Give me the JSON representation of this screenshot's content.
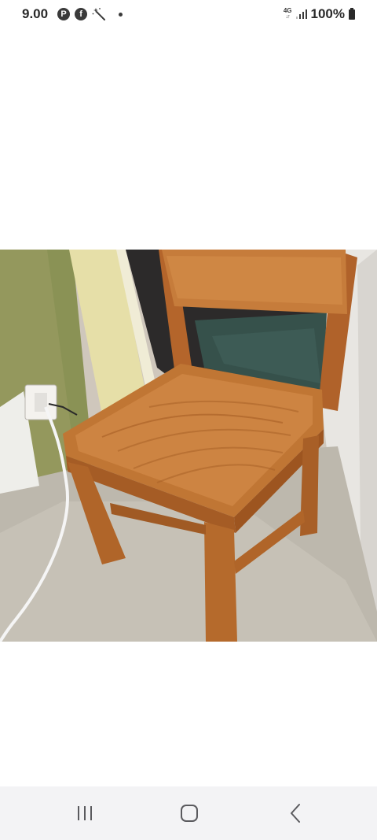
{
  "status_bar": {
    "time": "9.00",
    "notification_icons": [
      "pinterest-icon",
      "facebook-icon",
      "magic-wand-icon",
      "dot-icon"
    ],
    "network": "4G",
    "battery": "100%"
  },
  "image": {
    "icon": "chair-photo"
  },
  "nav_bar": {
    "buttons": [
      "recents-icon",
      "home-icon",
      "back-icon"
    ]
  }
}
